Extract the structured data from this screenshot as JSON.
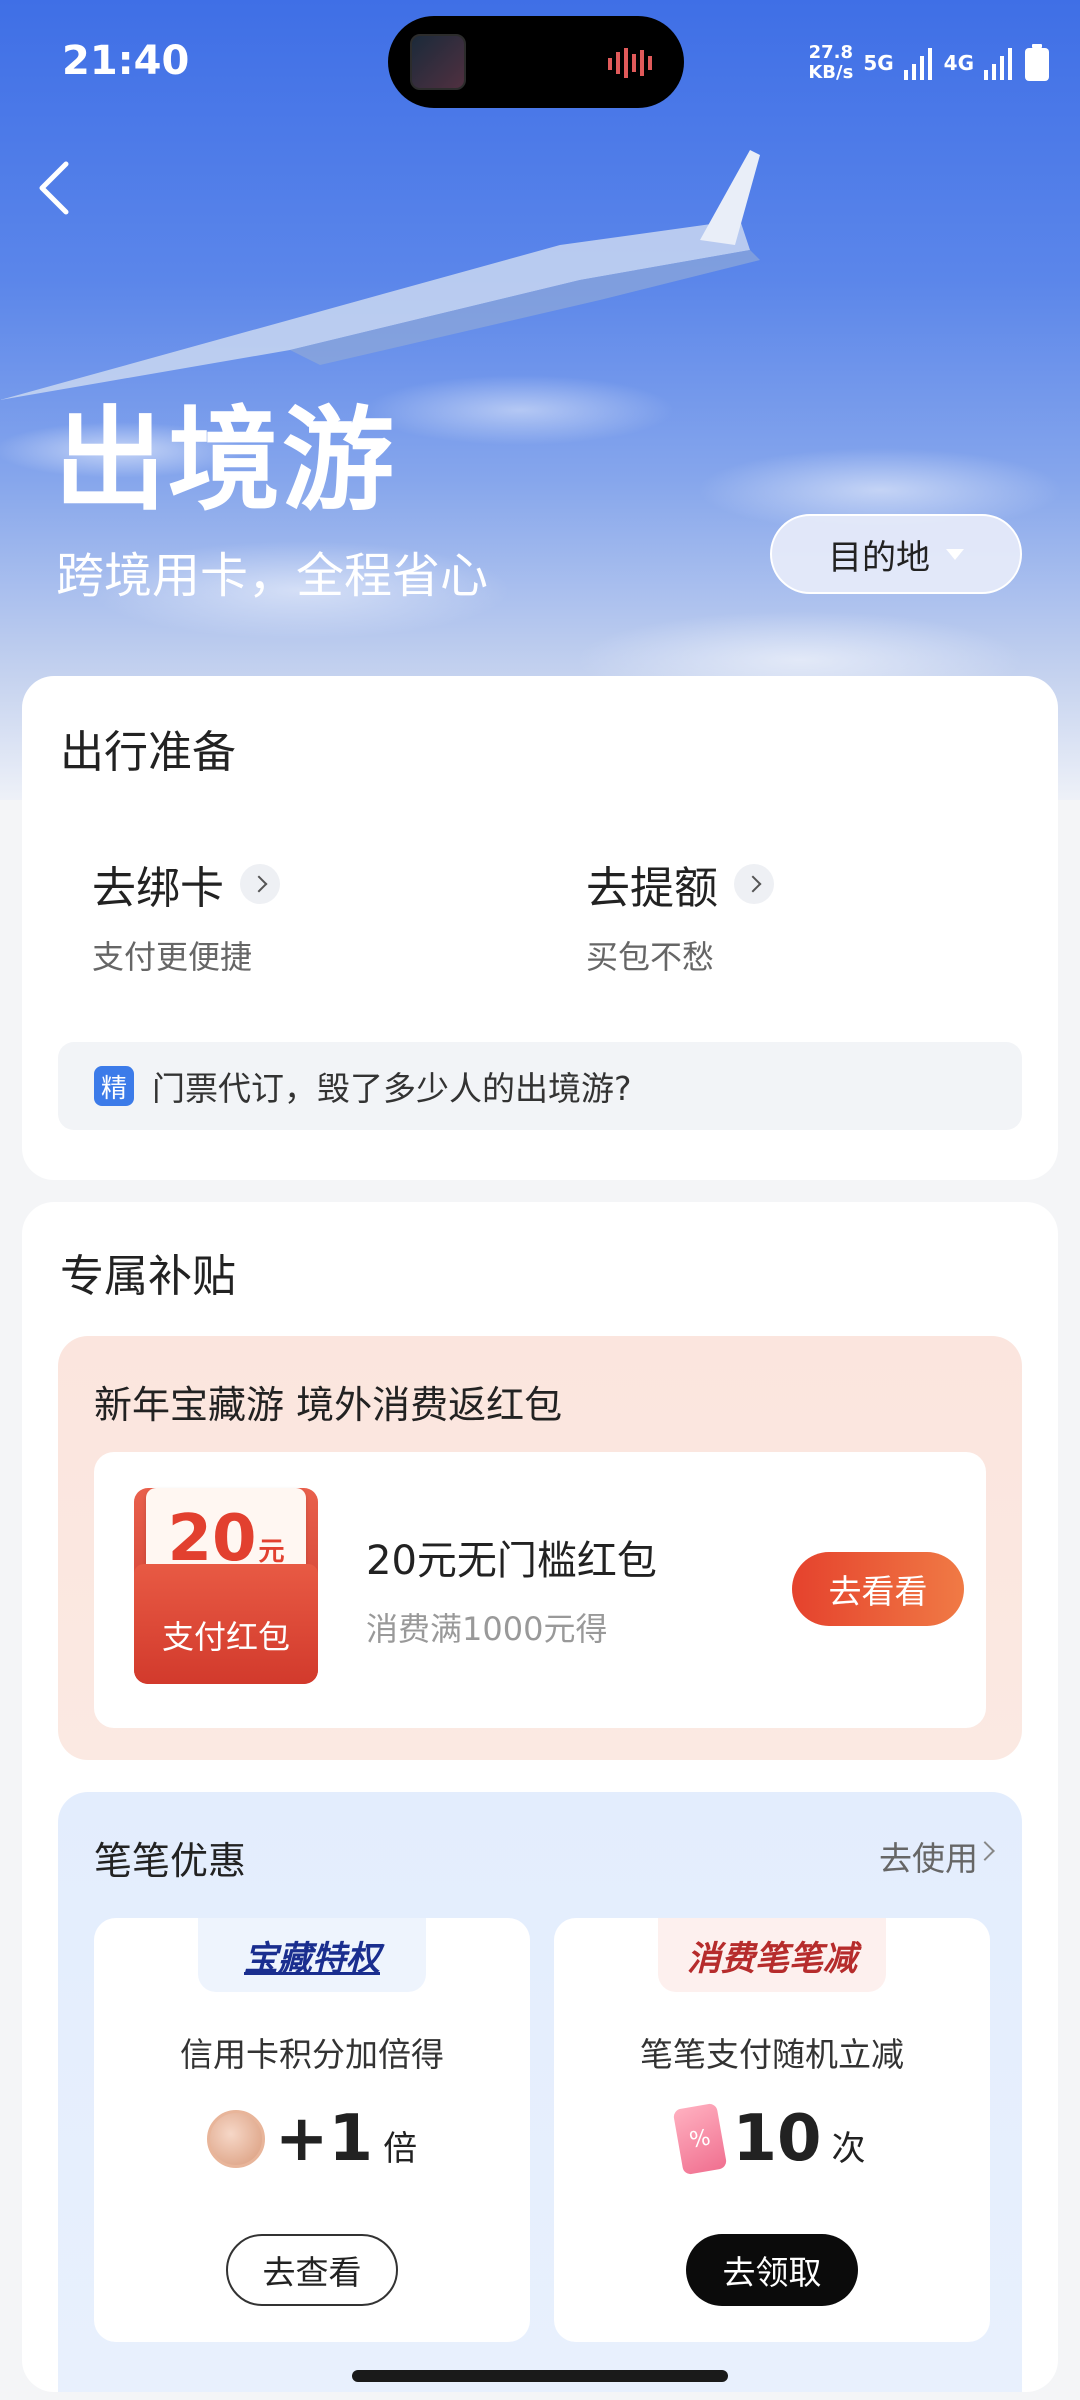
{
  "status_bar": {
    "time": "21:40",
    "speed_value": "27.8",
    "speed_unit": "KB/s",
    "net1": "5G",
    "net2": "4G"
  },
  "hero": {
    "title": "出境游",
    "subtitle": "跨境用卡，全程省心",
    "destination_label": "目的地"
  },
  "prep": {
    "title": "出行准备",
    "actions": [
      {
        "name": "去绑卡",
        "desc": "支付更便捷"
      },
      {
        "name": "去提额",
        "desc": "买包不愁"
      }
    ],
    "tip_badge": "精",
    "tip_text": "门票代订，毁了多少人的出境游?"
  },
  "subsidy": {
    "title": "专属补贴",
    "promo": {
      "title": "新年宝藏游 境外消费返红包",
      "envelope_amount": "20",
      "envelope_unit": "元",
      "envelope_label": "支付红包",
      "item_title": "20元无门槛红包",
      "item_desc": "消费满1000元得",
      "button": "去看看"
    },
    "deals": {
      "title": "笔笔优惠",
      "use_label": "去使用",
      "boxes": [
        {
          "tag": "宝藏特权",
          "desc": "信用卡积分加倍得",
          "value": "+1",
          "unit": "倍",
          "button": "去查看"
        },
        {
          "tag": "消费笔笔减",
          "desc": "笔笔支付随机立减",
          "value": "10",
          "unit": "次",
          "button": "去领取"
        }
      ]
    }
  }
}
